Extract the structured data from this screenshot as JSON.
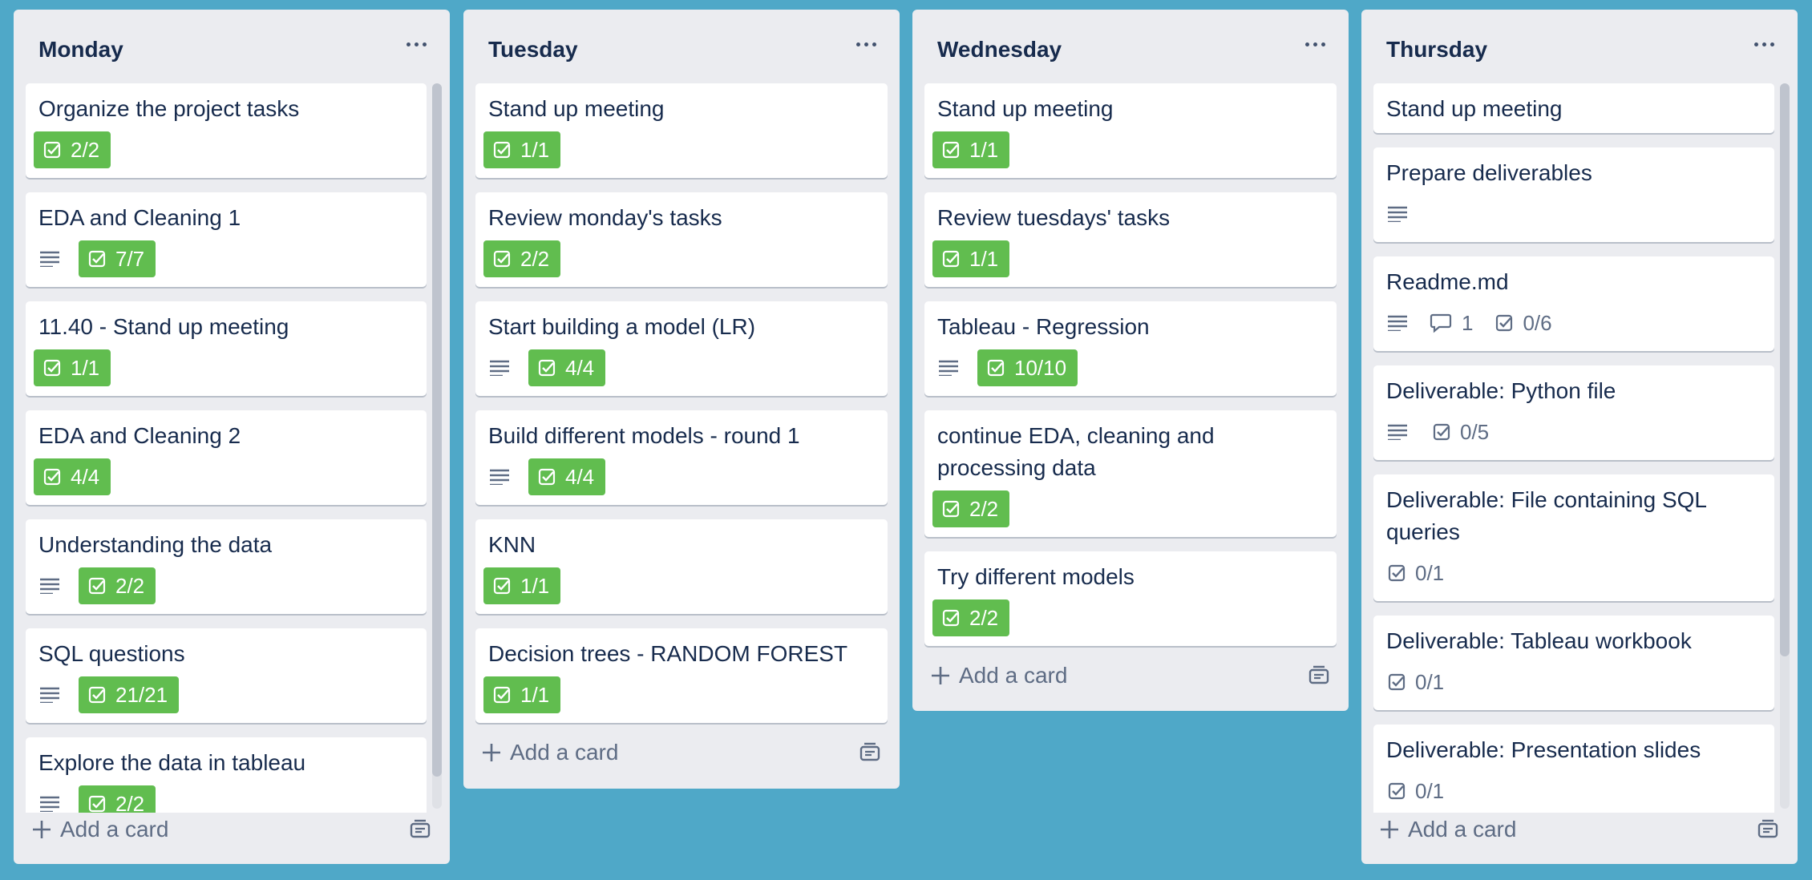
{
  "colors": {
    "board_background": "#4fa8c8",
    "list_background": "#ebecf0",
    "complete_badge": "#61bd4f",
    "text": "#172b4d",
    "muted_text": "#5e6c84"
  },
  "lists": [
    {
      "title": "Monday",
      "add_card_label": "Add a card",
      "cards": [
        {
          "title": "Organize the project tasks",
          "checklist": "2/2",
          "checklist_complete": true
        },
        {
          "title": "EDA and Cleaning 1",
          "has_description": true,
          "checklist": "7/7",
          "checklist_complete": true
        },
        {
          "title": "11.40 - Stand up meeting",
          "checklist": "1/1",
          "checklist_complete": true
        },
        {
          "title": "EDA and Cleaning 2",
          "checklist": "4/4",
          "checklist_complete": true
        },
        {
          "title": "Understanding the data",
          "has_description": true,
          "checklist": "2/2",
          "checklist_complete": true
        },
        {
          "title": "SQL questions",
          "has_description": true,
          "checklist": "21/21",
          "checklist_complete": true
        },
        {
          "title": "Explore the data in tableau",
          "has_description": true,
          "checklist": "2/2",
          "checklist_complete": true
        }
      ]
    },
    {
      "title": "Tuesday",
      "add_card_label": "Add a card",
      "cards": [
        {
          "title": "Stand up meeting",
          "checklist": "1/1",
          "checklist_complete": true
        },
        {
          "title": "Review monday's tasks",
          "checklist": "2/2",
          "checklist_complete": true
        },
        {
          "title": "Start building a model (LR)",
          "has_description": true,
          "checklist": "4/4",
          "checklist_complete": true
        },
        {
          "title": "Build different models - round 1",
          "has_description": true,
          "checklist": "4/4",
          "checklist_complete": true
        },
        {
          "title": "KNN",
          "checklist": "1/1",
          "checklist_complete": true
        },
        {
          "title": "Decision trees - RANDOM FOREST",
          "checklist": "1/1",
          "checklist_complete": true
        }
      ]
    },
    {
      "title": "Wednesday",
      "add_card_label": "Add a card",
      "cards": [
        {
          "title": "Stand up meeting",
          "checklist": "1/1",
          "checklist_complete": true
        },
        {
          "title": "Review tuesdays' tasks",
          "checklist": "1/1",
          "checklist_complete": true
        },
        {
          "title": "Tableau - Regression",
          "has_description": true,
          "checklist": "10/10",
          "checklist_complete": true
        },
        {
          "title": "continue EDA, cleaning and processing data",
          "checklist": "2/2",
          "checklist_complete": true
        },
        {
          "title": "Try different models",
          "checklist": "2/2",
          "checklist_complete": true
        }
      ]
    },
    {
      "title": "Thursday",
      "add_card_label": "Add a card",
      "cards": [
        {
          "title": "Stand up meeting"
        },
        {
          "title": "Prepare deliverables",
          "has_description": true
        },
        {
          "title": "Readme.md",
          "has_description": true,
          "comments": "1",
          "checklist": "0/6",
          "checklist_complete": false
        },
        {
          "title": "Deliverable: Python file",
          "has_description": true,
          "checklist": "0/5",
          "checklist_complete": false
        },
        {
          "title": "Deliverable: File containing SQL queries",
          "checklist": "0/1",
          "checklist_complete": false
        },
        {
          "title": "Deliverable: Tableau workbook",
          "checklist": "0/1",
          "checklist_complete": false
        },
        {
          "title": "Deliverable: Presentation slides",
          "checklist": "0/1",
          "checklist_complete": false
        }
      ]
    }
  ]
}
